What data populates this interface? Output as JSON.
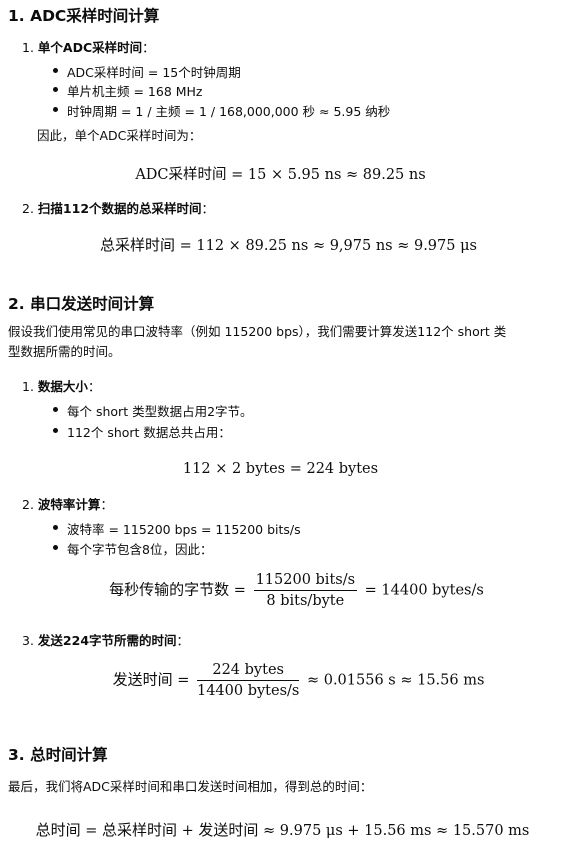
{
  "s1": {
    "heading": "1. ADC采样时间计算",
    "item1": {
      "num": "1.",
      "title": "单个ADC采样时间",
      "colon": "："
    },
    "bullets": [
      "ADC采样时间 = 15个时钟周期",
      "单片机主频 = 168 MHz",
      "时钟周期 = 1 / 主频 = 1 / 168,000,000 秒 ≈ 5.95 纳秒"
    ],
    "therefore": "因此，单个ADC采样时间为：",
    "eq1": {
      "lhs": "ADC采样时间",
      "rhs": " = 15 × 5.95 ns ≈ 89.25 ns"
    },
    "item2": {
      "num": "2.",
      "title": "扫描112个数据的总采样时间",
      "colon": "："
    },
    "eq2": {
      "lhs": "总采样时间",
      "rhs": " = 112 × 89.25 ns ≈ 9,975 ns ≈ 9.975 μs"
    }
  },
  "s2": {
    "heading": "2. 串口发送时间计算",
    "para_line1": "假设我们使用常见的串口波特率（例如 115200 bps），我们需要计算发送112个 short 类",
    "para_line2": "型数据所需的时间。",
    "item1": {
      "num": "1.",
      "title": "数据大小",
      "colon": "："
    },
    "bullets1": [
      "每个 short 类型数据占用2字节。",
      "112个 short 数据总共占用："
    ],
    "eq1": "112 × 2 bytes = 224 bytes",
    "item2": {
      "num": "2.",
      "title": "波特率计算",
      "colon": "："
    },
    "bullets2": [
      "波特率 = 115200 bps = 115200 bits/s",
      "每个字节包含8位，因此："
    ],
    "eq2": {
      "lhs": "每秒传输的字节数",
      "eq": " = ",
      "num": "115200 bits/s",
      "den": "8 bits/byte",
      "rhs": " = 14400 bytes/s"
    },
    "item3": {
      "num": "3.",
      "title": "发送224字节所需的时间",
      "colon": "："
    },
    "eq3": {
      "lhs": "发送时间",
      "eq": " = ",
      "num": "224 bytes",
      "den": "14400 bytes/s",
      "rhs": " ≈ 0.01556 s ≈ 15.56 ms"
    }
  },
  "s3": {
    "heading": "3. 总时间计算",
    "para": "最后，我们将ADC采样时间和串口发送时间相加，得到总的时间：",
    "eq": {
      "lhs": "总时间",
      "mid1": " = ",
      "a": "总采样时间",
      "mid2": " + ",
      "b": "发送时间",
      "rhs": " ≈ 9.975 μs + 15.56 ms ≈ 15.570 ms"
    }
  }
}
